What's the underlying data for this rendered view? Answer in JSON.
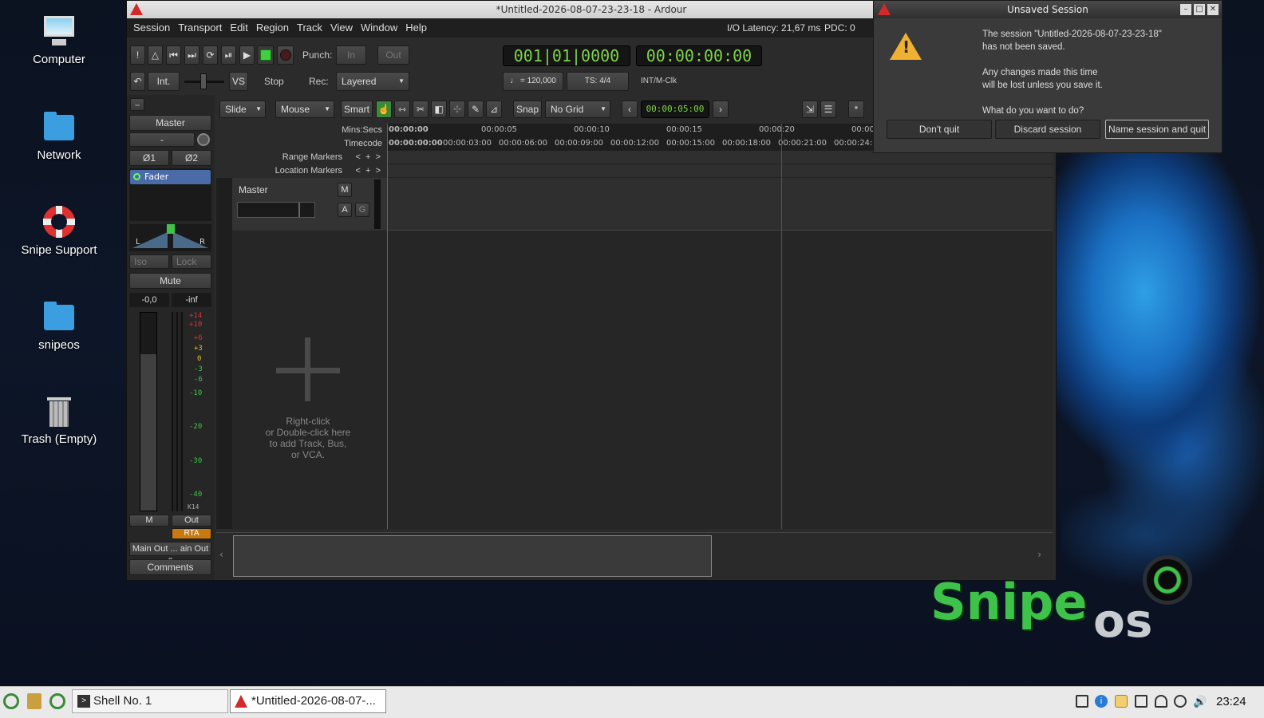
{
  "desktop": {
    "icons": [
      {
        "label": "Computer"
      },
      {
        "label": "Network"
      },
      {
        "label": "Snipe Support"
      },
      {
        "label": "snipeos"
      },
      {
        "label": "Trash (Empty)"
      }
    ],
    "brand": {
      "main": "Snipe",
      "sub": "os"
    }
  },
  "ardour": {
    "title": "*Untitled-2026-08-07-23-23-18 - Ardour",
    "menu": [
      "Session",
      "Transport",
      "Edit",
      "Region",
      "Track",
      "View",
      "Window",
      "Help"
    ],
    "latency": "I/O Latency: 21,67 ms",
    "pdc": "PDC: 0",
    "punch_label": "Punch:",
    "punch_in": "In",
    "punch_out": "Out",
    "rec_label": "Rec:",
    "rec_mode": "Layered",
    "int_label": "Int.",
    "vs_label": "VS",
    "stop_label": "Stop",
    "primary_clock": "001|01|0000",
    "secondary_clock": "00:00:00:00",
    "tempo": "♩ = 120,000",
    "meter": "TS: 4/4",
    "sync": "INT/M-Clk",
    "edit_toolbar": {
      "edit_mode": "Slide",
      "ripple": "Mouse",
      "smart": "Smart",
      "snap": "Snap",
      "grid": "No Grid",
      "nudge_clock": "00:00:05:00",
      "star": "*"
    },
    "rulers": {
      "mins_label": "Mins:Secs",
      "timecode_label": "Timecode",
      "range_label": "Range Markers",
      "location_label": "Location Markers",
      "mins_ticks": [
        "00:00:00",
        "00:00:05",
        "00:00:10",
        "00:00:15",
        "00:00:20",
        "00:00"
      ],
      "tc_ticks": [
        "00:00:00:00",
        "00:00:03:00",
        "00:00:06:00",
        "00:00:09:00",
        "00:00:12:00",
        "00:00:15:00",
        "00:00:18:00",
        "00:00:21:00",
        "00:00:24:0"
      ]
    },
    "track": {
      "name": "Master",
      "mute": "M",
      "auto": "A",
      "group": "G"
    },
    "add_hint": [
      "Right-click",
      "or Double-click here",
      "to add Track, Bus,",
      "or VCA."
    ],
    "strip": {
      "name": "Master",
      "input": "-",
      "phase1": "Ø1",
      "phase2": "Ø2",
      "fader_plugin": "Fader",
      "pan_l": "L",
      "pan_r": "R",
      "iso": "Iso",
      "lock": "Lock",
      "mute": "Mute",
      "gain": "-0,0",
      "peak": "-inf",
      "meter_scale": [
        "+14",
        "+10",
        "+6",
        "+3",
        "0",
        "-3",
        "-6",
        "-10",
        "-20",
        "-30",
        "-40"
      ],
      "meter_type": "K14",
      "m_btn": "M",
      "out_btn": "Out",
      "rta": "RTA",
      "output": "Main Out ... ain Out 2",
      "comments": "Comments"
    }
  },
  "dialog": {
    "title": "Unsaved Session",
    "message_1": "The session \"Untitled-2026-08-07-23-23-18\"",
    "message_2": "has not been saved.",
    "message_3": "Any changes made this time",
    "message_4": "will be lost unless you save it.",
    "question": "What do you want to do?",
    "btn_dont_quit": "Don't quit",
    "btn_discard": "Discard session",
    "btn_name_quit": "Name session and quit"
  },
  "taskbar": {
    "shell": "Shell No. 1",
    "ardour_task": "*Untitled-2026-08-07-...",
    "time": "23:24"
  }
}
